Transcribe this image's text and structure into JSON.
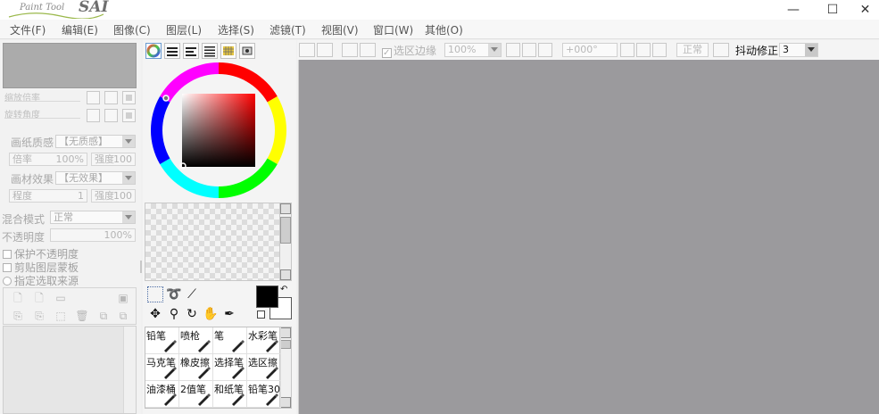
{
  "app": {
    "logo_subtitle": "Paint Tool",
    "logo_title": "SAI"
  },
  "window_controls": {
    "minimize": "—",
    "maximize": "☐",
    "close": "✕"
  },
  "menu": [
    "文件(F)",
    "编辑(E)",
    "图像(C)",
    "图层(L)",
    "选择(S)",
    "滤镜(T)",
    "视图(V)",
    "窗口(W)",
    "其他(O)"
  ],
  "left_panel": {
    "zoom_label": "缩放倍率",
    "rotate_label": "旋转角度",
    "paper_texture": {
      "label": "画纸质感",
      "value": "【无质感】"
    },
    "scale": {
      "label": "倍率",
      "value": "100%"
    },
    "strength1": {
      "label": "强度",
      "value": "100"
    },
    "material": {
      "label": "画材效果",
      "value": "【无效果】"
    },
    "degree": {
      "label": "程度",
      "value": "1"
    },
    "strength2": {
      "label": "强度",
      "value": "100"
    },
    "blend_mode": {
      "label": "混合模式",
      "value": "正常"
    },
    "opacity": {
      "label": "不透明度",
      "value": "100%"
    },
    "checks": [
      "保护不透明度",
      "剪贴图层蒙板"
    ],
    "radio": "指定选取来源"
  },
  "brushes": [
    [
      "铅笔",
      "喷枪",
      "笔",
      "水彩笔"
    ],
    [
      "马克笔",
      "橡皮擦",
      "选择笔",
      "选区擦"
    ],
    [
      "油漆桶",
      "2值笔",
      "和纸笔",
      "铅笔30"
    ]
  ],
  "toolbar": {
    "selection_edge": "选区边缘",
    "zoom": "100%",
    "angle": "+000°",
    "mode": "正常",
    "stabilizer_label": "抖动修正",
    "stabilizer_value": "3"
  },
  "colors": {
    "primary": "#000000",
    "secondary": "#ffffff",
    "canvas_bg": "#9b9a9d"
  }
}
